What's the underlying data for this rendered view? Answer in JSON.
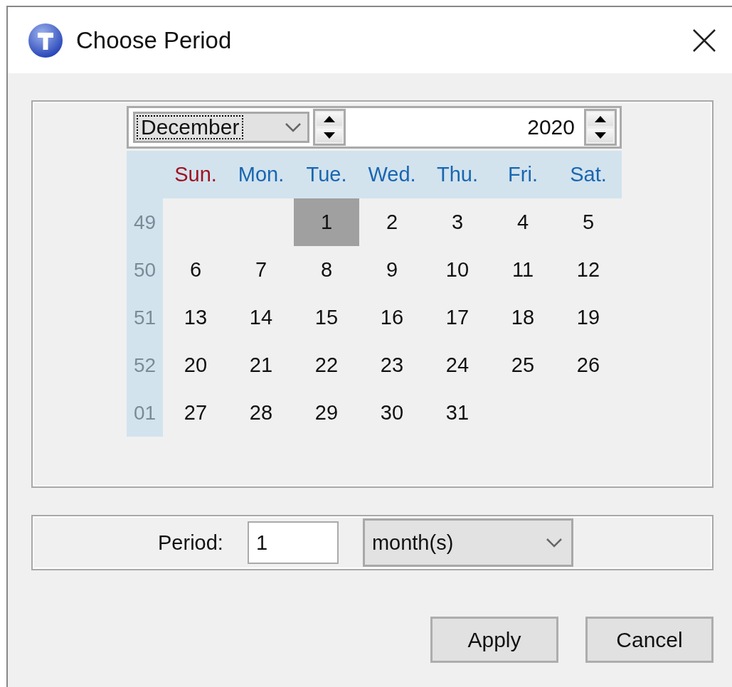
{
  "window": {
    "title": "Choose Period"
  },
  "calendar": {
    "month": "December",
    "year": "2020",
    "day_headers": [
      {
        "label": "Sun.",
        "color": "#a01020"
      },
      {
        "label": "Mon.",
        "color": "#1a66b0"
      },
      {
        "label": "Tue.",
        "color": "#1a66b0"
      },
      {
        "label": "Wed.",
        "color": "#1a66b0"
      },
      {
        "label": "Thu.",
        "color": "#1a66b0"
      },
      {
        "label": "Fri.",
        "color": "#1a66b0"
      },
      {
        "label": "Sat.",
        "color": "#1a66b0"
      }
    ],
    "weeks": [
      {
        "number": "49",
        "days": [
          {
            "kind": "blank"
          },
          {
            "kind": "blank"
          },
          {
            "kind": "day",
            "label": "1",
            "selected": true
          },
          {
            "kind": "day",
            "label": "2",
            "selected": false
          },
          {
            "kind": "day",
            "label": "3",
            "selected": false
          },
          {
            "kind": "day",
            "label": "4",
            "selected": false
          },
          {
            "kind": "day",
            "label": "5",
            "selected": false
          }
        ]
      },
      {
        "number": "50",
        "days": [
          {
            "kind": "day",
            "label": "6",
            "selected": false
          },
          {
            "kind": "day",
            "label": "7",
            "selected": false
          },
          {
            "kind": "day",
            "label": "8",
            "selected": false
          },
          {
            "kind": "day",
            "label": "9",
            "selected": false
          },
          {
            "kind": "day",
            "label": "10",
            "selected": false
          },
          {
            "kind": "day",
            "label": "11",
            "selected": false
          },
          {
            "kind": "day",
            "label": "12",
            "selected": false
          }
        ]
      },
      {
        "number": "51",
        "days": [
          {
            "kind": "day",
            "label": "13",
            "selected": false
          },
          {
            "kind": "day",
            "label": "14",
            "selected": false
          },
          {
            "kind": "day",
            "label": "15",
            "selected": false
          },
          {
            "kind": "day",
            "label": "16",
            "selected": false
          },
          {
            "kind": "day",
            "label": "17",
            "selected": false
          },
          {
            "kind": "day",
            "label": "18",
            "selected": false
          },
          {
            "kind": "day",
            "label": "19",
            "selected": false
          }
        ]
      },
      {
        "number": "52",
        "days": [
          {
            "kind": "day",
            "label": "20",
            "selected": false
          },
          {
            "kind": "day",
            "label": "21",
            "selected": false
          },
          {
            "kind": "day",
            "label": "22",
            "selected": false
          },
          {
            "kind": "day",
            "label": "23",
            "selected": false
          },
          {
            "kind": "day",
            "label": "24",
            "selected": false
          },
          {
            "kind": "day",
            "label": "25",
            "selected": false
          },
          {
            "kind": "day",
            "label": "26",
            "selected": false
          }
        ]
      },
      {
        "number": "01",
        "days": [
          {
            "kind": "day",
            "label": "27",
            "selected": false
          },
          {
            "kind": "day",
            "label": "28",
            "selected": false
          },
          {
            "kind": "day",
            "label": "29",
            "selected": false
          },
          {
            "kind": "day",
            "label": "30",
            "selected": false
          },
          {
            "kind": "day",
            "label": "31",
            "selected": false
          },
          {
            "kind": "blank"
          },
          {
            "kind": "blank"
          }
        ]
      }
    ]
  },
  "period": {
    "label": "Period:",
    "value": "1",
    "unit": "month(s)"
  },
  "buttons": [
    "Apply",
    "Cancel"
  ]
}
